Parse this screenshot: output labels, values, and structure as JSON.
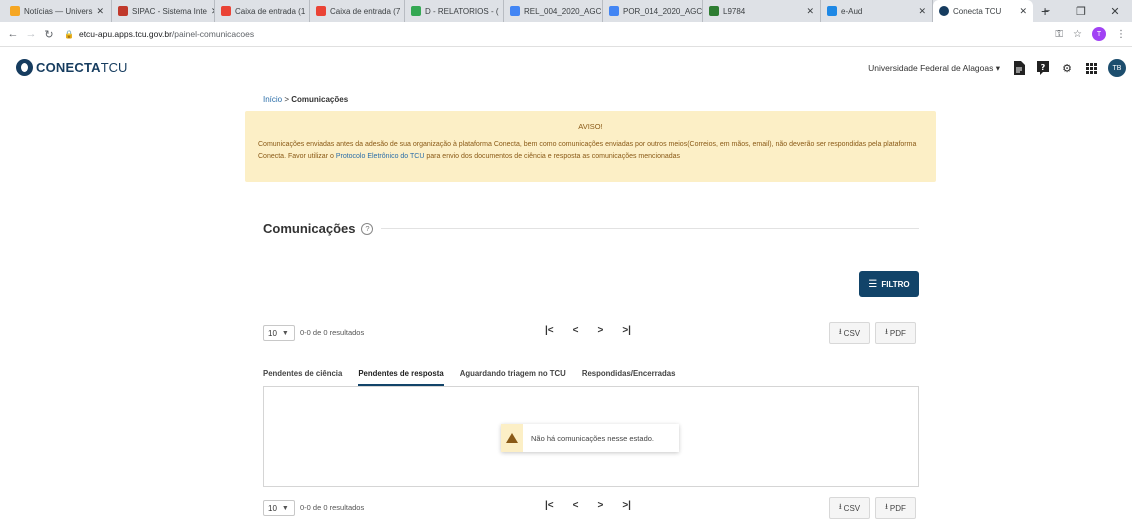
{
  "browser": {
    "tabs": [
      {
        "label": "Notícias — Univers",
        "color": "#f5a623"
      },
      {
        "label": "SIPAC - Sistema Inte",
        "color": "#c0392b"
      },
      {
        "label": "Caixa de entrada (1",
        "color": "#ea4335"
      },
      {
        "label": "Caixa de entrada (7",
        "color": "#ea4335"
      },
      {
        "label": "D - RELATORIOS - (",
        "color": "#34a853"
      },
      {
        "label": "REL_004_2020_AGC",
        "color": "#4285f4"
      },
      {
        "label": "POR_014_2020_AGC",
        "color": "#4285f4"
      },
      {
        "label": "L9784",
        "color": "#2e7d32"
      },
      {
        "label": "e-Aud",
        "color": "#1e88e5"
      },
      {
        "label": "Conecta TCU",
        "color": "#163c5f"
      }
    ],
    "new_tab": "+",
    "url_host": "etcu-apu.apps.tcu.gov.br",
    "url_path": "/painel-comunicacoes",
    "profile_initial": "T"
  },
  "header": {
    "logo_bold": "CONECTA",
    "logo_normal": "TCU",
    "org": "Universidade Federal de Alagoas ▾",
    "avatar": "TB"
  },
  "breadcrumb": {
    "home": "Início",
    "sep": " > ",
    "current": "Comunicações"
  },
  "notice": {
    "title": "AVISO!",
    "text_before": "Comunicações enviadas antes da adesão de sua organização à plataforma Conecta, bem como comunicações enviadas por outros meios(Correios, em mãos, email), não deverão ser respondidas pela plataforma Conecta. Favor utilizar o ",
    "link": "Protocolo Eletrônico do TCU",
    "text_after": " para envio dos documentos de ciência e resposta as comunicações mencionadas"
  },
  "section": {
    "title": "Comunicações",
    "help": "?"
  },
  "filter_button": "FILTRO",
  "pager": {
    "page_size": "10",
    "results": "0-0 de 0 resultados",
    "first": "|<",
    "prev": "<",
    "next": ">",
    "last": ">|",
    "csv": "CSV",
    "pdf": "PDF"
  },
  "tabs": [
    {
      "label": "Pendentes de ciência",
      "active": false
    },
    {
      "label": "Pendentes de resposta",
      "active": true
    },
    {
      "label": "Aguardando triagem no TCU",
      "active": false
    },
    {
      "label": "Respondidas/Encerradas",
      "active": false
    }
  ],
  "empty_message": "Não há comunicações nesse estado."
}
